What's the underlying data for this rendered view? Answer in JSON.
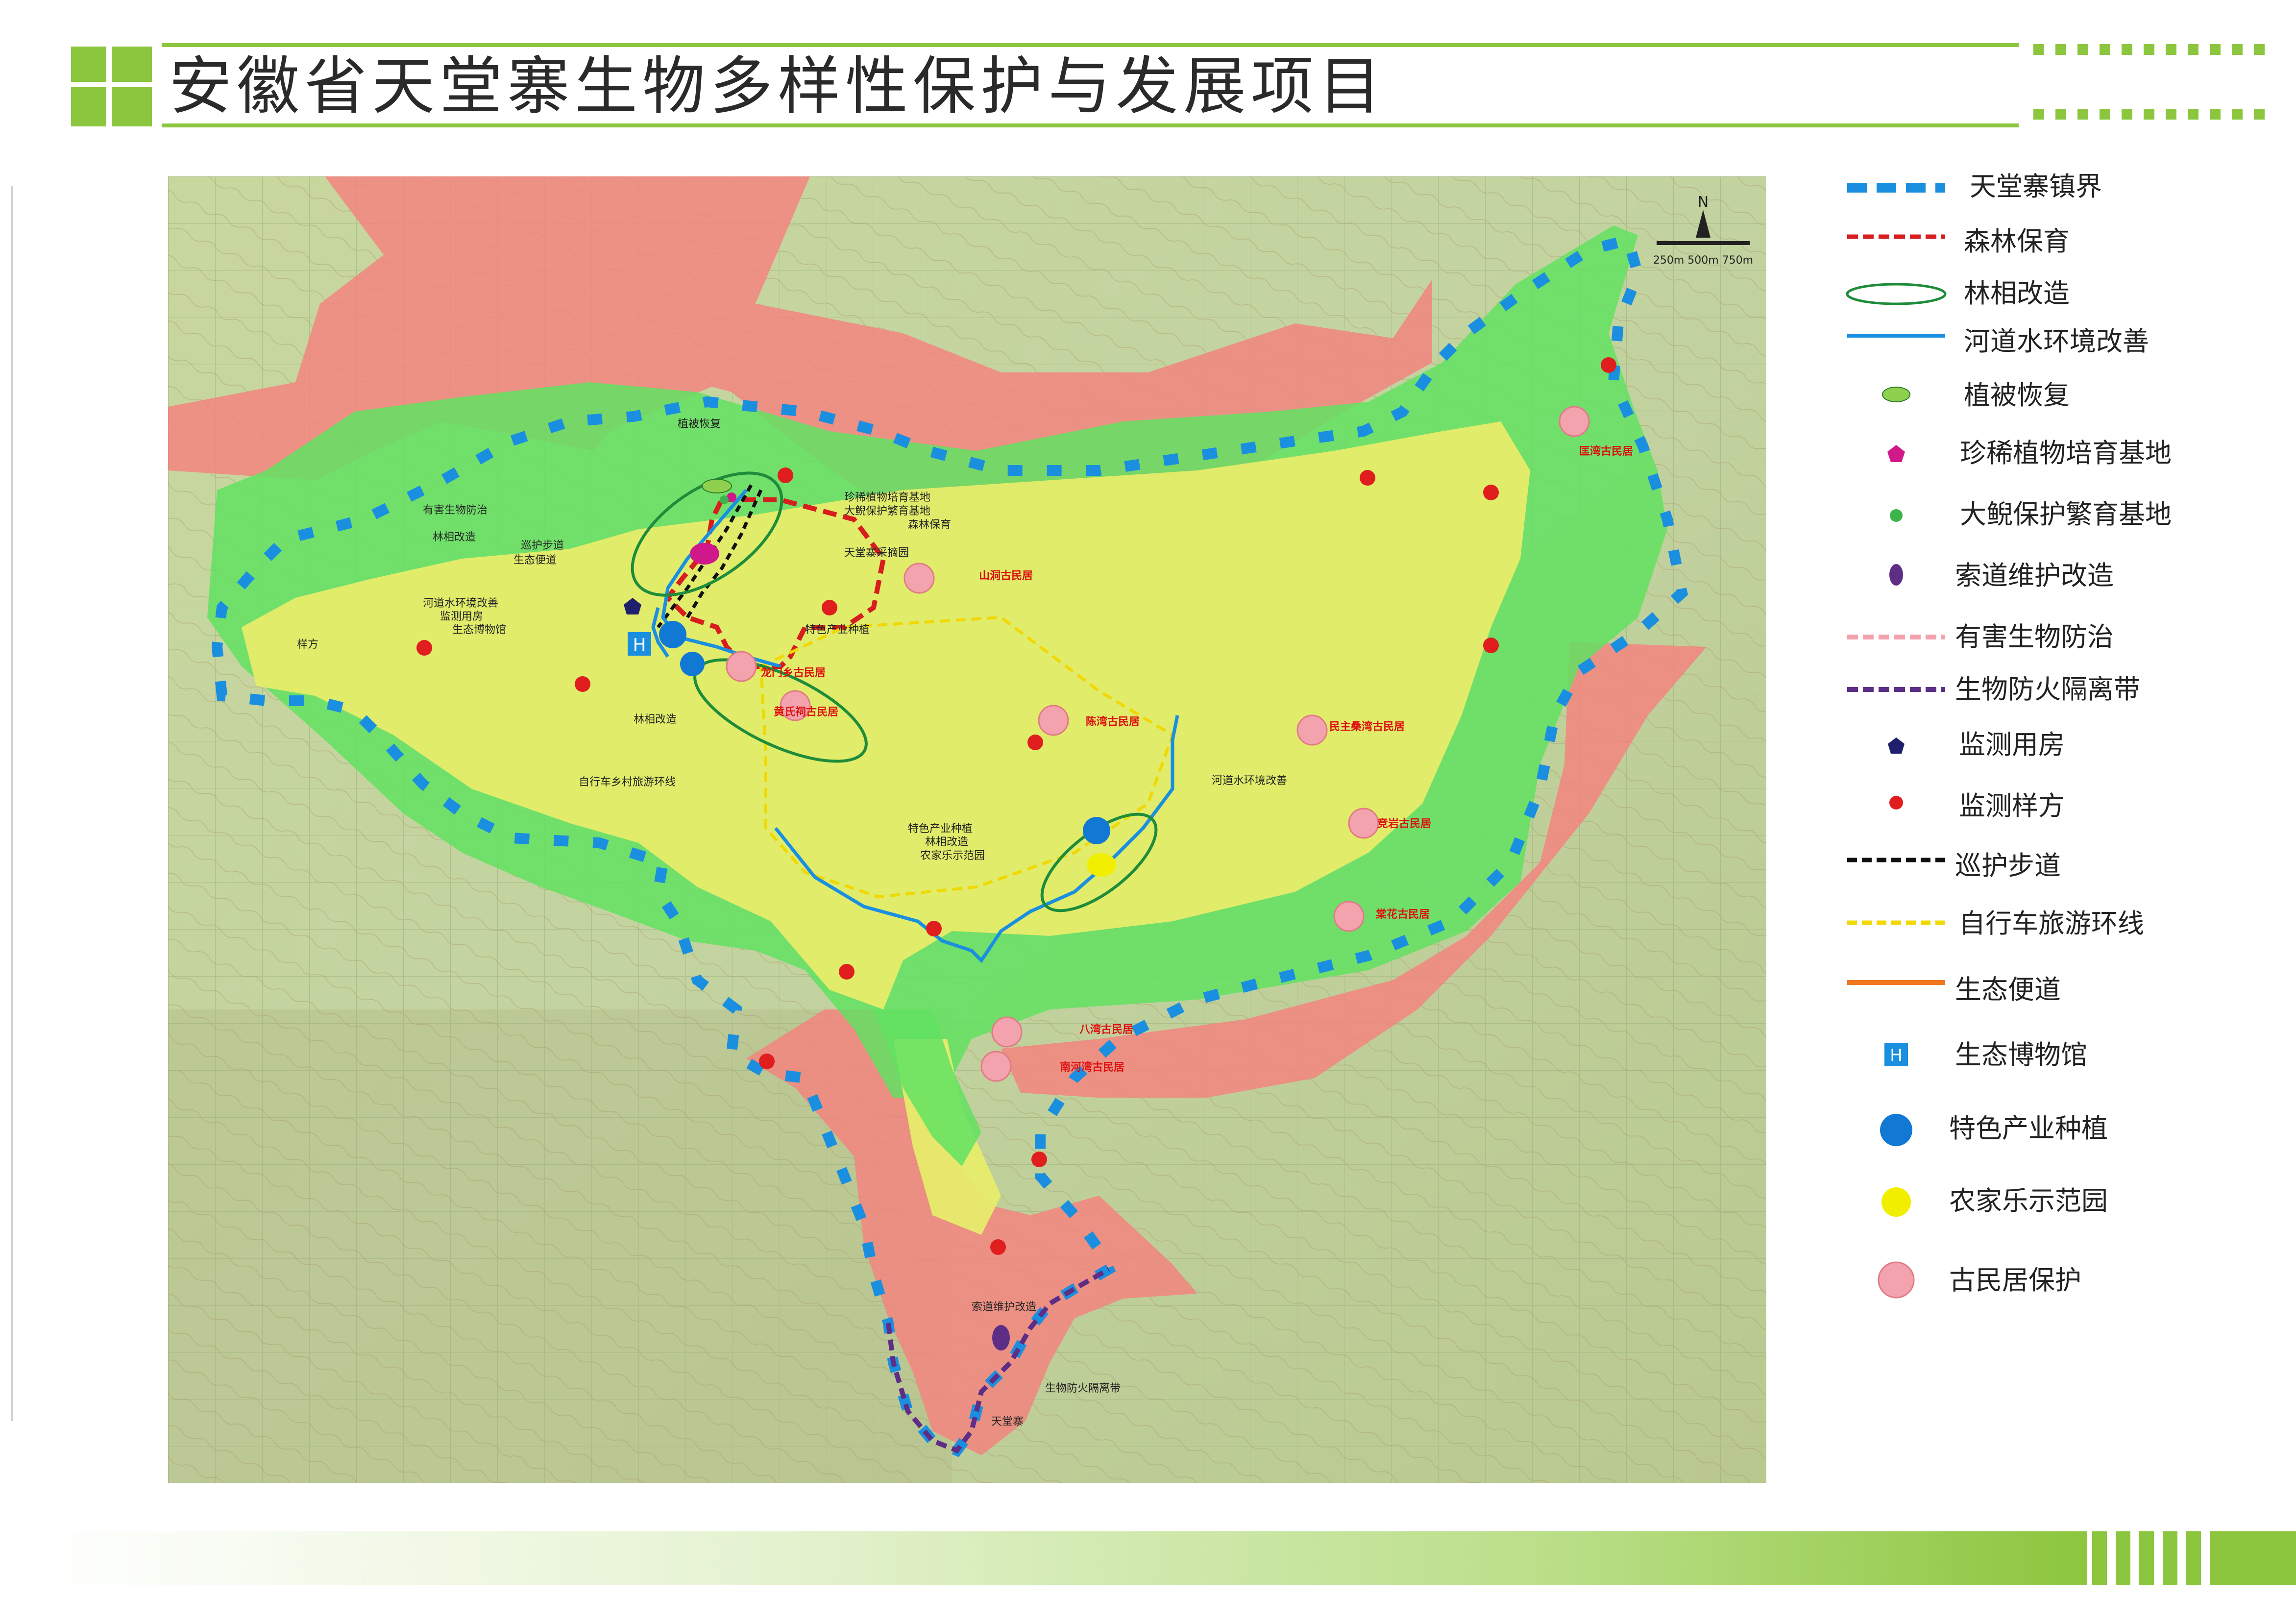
{
  "header": {
    "title": "安徽省天堂寨生物多样性保护与发展项目"
  },
  "colors": {
    "accent_green": "#8cc63e",
    "boundary_blue": "#1a8fe0",
    "forest_red": "#e02020",
    "zone_green": "#6fe06f",
    "zone_yellow": "#e6ec6a",
    "zone_red": "#f08080"
  },
  "legend": {
    "items": [
      {
        "label": "天堂寨镇界",
        "icon": "town-boundary-dashed-blue-line"
      },
      {
        "label": "森林保育",
        "icon": "forest-conservation-dashed-red-line"
      },
      {
        "label": "林相改造",
        "icon": "forest-reform-green-ellipse"
      },
      {
        "label": "河道水环境改善",
        "icon": "river-blue-line"
      },
      {
        "label": "植被恢复",
        "icon": "vegetation-green-ellipse"
      },
      {
        "label": "珍稀植物培育基地",
        "icon": "rare-plant-magenta-pentagon"
      },
      {
        "label": "大鲵保护繁育基地",
        "icon": "salamander-green-dot"
      },
      {
        "label": "索道维护改造",
        "icon": "cableway-purple-oval"
      },
      {
        "label": "有害生物防治",
        "icon": "pest-control-pink-dashed-line"
      },
      {
        "label": "生物防火隔离带",
        "icon": "firebreak-purple-dashed-line"
      },
      {
        "label": "监测用房",
        "icon": "monitor-house-navy-pentagon"
      },
      {
        "label": "监测样方",
        "icon": "monitor-plot-red-dot"
      },
      {
        "label": "巡护步道",
        "icon": "patrol-path-black-dashed-line"
      },
      {
        "label": "自行车旅游环线",
        "icon": "bike-loop-yellow-dashed-line"
      },
      {
        "label": "生态便道",
        "icon": "eco-path-orange-line"
      },
      {
        "label": "生态博物馆",
        "icon": "museum-blue-square-h"
      },
      {
        "label": "特色产业种植",
        "icon": "specialty-blue-circle"
      },
      {
        "label": "农家乐示范园",
        "icon": "farmstay-yellow-circle"
      },
      {
        "label": "古民居保护",
        "icon": "old-house-pink-circle"
      }
    ]
  },
  "map": {
    "compass_letter": "N",
    "scale_text": "250m 500m 750m",
    "museum_letter": "H",
    "annotations_black": [
      "植被恢复",
      "珍稀植物培育基地",
      "大鲵保护繁育基地",
      "森林保育",
      "天堂寨采摘园",
      "有害生物防治",
      "巡护步道",
      "林相改造",
      "生态便道",
      "河道水环境改善",
      "监测用房",
      "生态博物馆",
      "样方",
      "特色产业种植",
      "林相改造",
      "自行车乡村旅游环线",
      "特色产业种植",
      "林相改造",
      "农家乐示范园",
      "河道水环境改善",
      "索道维护改造",
      "生物防火隔离带",
      "天堂寨"
    ],
    "village_labels_red": [
      "山洞古民居",
      "龙门乡古民居",
      "黄氏祠古民居",
      "陈湾古民居",
      "民主桑湾古民居",
      "竞岩古民居",
      "棠花古民居",
      "八湾古民居",
      "南河湾古民居",
      "匡湾古民居"
    ]
  }
}
